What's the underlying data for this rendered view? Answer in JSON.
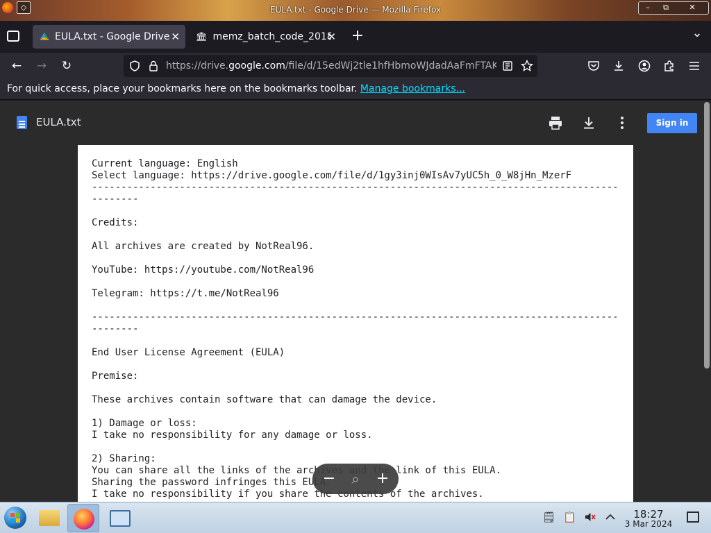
{
  "window": {
    "title": "EULA.txt - Google Drive — Mozilla Firefox",
    "minimize": "–",
    "maximize": "⧉",
    "close": "✕"
  },
  "tabs": [
    {
      "label": "EULA.txt - Google Drive",
      "close": "✕"
    },
    {
      "label": "memz_batch_code_2018",
      "close": "✕"
    }
  ],
  "new_tab": "+",
  "tab_list": "⌄",
  "nav": {
    "back": "←",
    "forward": "→",
    "reload": "↻",
    "url_prefix": "https://drive.",
    "url_domain": "google.com",
    "url_suffix": "/file/d/15edWj2tle1hfHbmoWJdadAaFmFTAK"
  },
  "bookmarks": {
    "message": "For quick access, place your bookmarks here on the bookmarks toolbar. ",
    "link": "Manage bookmarks..."
  },
  "viewer": {
    "file_title": "EULA.txt",
    "sign_in": "Sign in",
    "document_text": "Current language: English\nSelect language: https://drive.google.com/file/d/1gy3inj0WIsAv7yUC5h_0_W8jHn_MzerF\n------------------------------------------------------------------------------------------\n--------\n\nCredits:\n\nAll archives are created by NotReal96.\n\nYouTube: https://youtube.com/NotReal96\n\nTelegram: https://t.me/NotReal96\n\n------------------------------------------------------------------------------------------\n--------\n\nEnd User License Agreement (EULA)\n\nPremise:\n\nThese archives contain software that can damage the device.\n\n1) Damage or loss:\nI take no responsibility for any damage or loss.\n\n2) Sharing:\nYou can share all the links of the archives and the link of this EULA.\nSharing the password infringes this EULA.\nI take no responsibility if you share the contents of the archives.",
    "zoom_out": "−",
    "zoom_icon": "⌕",
    "zoom_in": "+"
  },
  "taskbar": {
    "time": "18:27",
    "date": "3 Mar 2024"
  },
  "colors": {
    "accent": "#4285f4",
    "link": "#00ddff",
    "tab_active": "#42414d"
  }
}
